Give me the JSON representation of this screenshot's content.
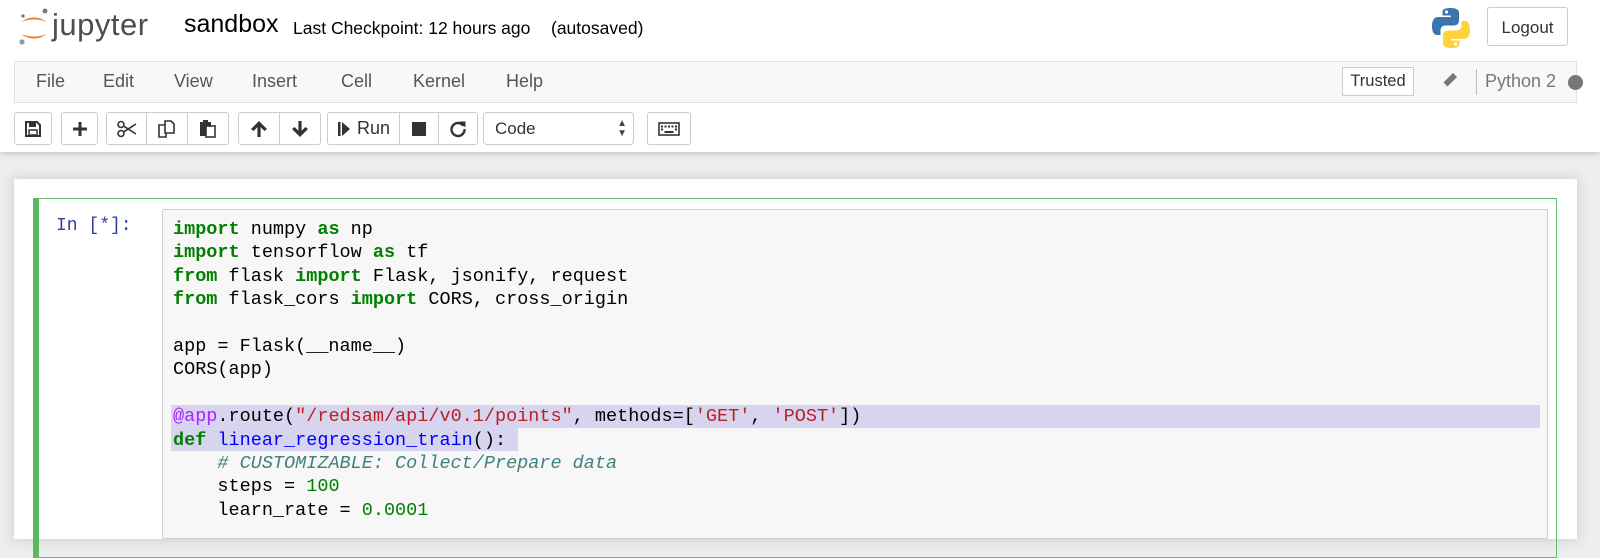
{
  "header": {
    "logo_text": "jupyter",
    "notebook_name": "sandbox",
    "checkpoint": "Last Checkpoint: 12 hours ago",
    "autosave": "(autosaved)",
    "logout_label": "Logout"
  },
  "menubar": {
    "items": [
      "File",
      "Edit",
      "View",
      "Insert",
      "Cell",
      "Kernel",
      "Help"
    ],
    "trusted_label": "Trusted",
    "kernel_name": "Python 2"
  },
  "toolbar": {
    "buttons": [
      "save-icon",
      "plus-icon",
      "scissors-icon",
      "copy-icon",
      "paste-icon",
      "arrow-up-icon",
      "arrow-down-icon",
      "run-icon",
      "stop-icon",
      "restart-icon",
      "keyboard-icon"
    ],
    "run_label": "Run",
    "cell_type": "Code"
  },
  "cell": {
    "prompt": "In [*]:",
    "lines": [
      [
        {
          "t": "import",
          "c": "kw"
        },
        {
          "t": " numpy ",
          "c": "plain"
        },
        {
          "t": "as",
          "c": "kw"
        },
        {
          "t": " np",
          "c": "plain"
        }
      ],
      [
        {
          "t": "import",
          "c": "kw"
        },
        {
          "t": " tensorflow ",
          "c": "plain"
        },
        {
          "t": "as",
          "c": "kw"
        },
        {
          "t": " tf",
          "c": "plain"
        }
      ],
      [
        {
          "t": "from",
          "c": "kw"
        },
        {
          "t": " flask ",
          "c": "plain"
        },
        {
          "t": "import",
          "c": "kw"
        },
        {
          "t": " Flask, jsonify, request",
          "c": "plain"
        }
      ],
      [
        {
          "t": "from",
          "c": "kw"
        },
        {
          "t": " flask_cors ",
          "c": "plain"
        },
        {
          "t": "import",
          "c": "kw"
        },
        {
          "t": " CORS, cross_origin",
          "c": "plain"
        }
      ],
      [],
      [
        {
          "t": "app = Flask(__name__)",
          "c": "plain"
        }
      ],
      [
        {
          "t": "CORS(app)",
          "c": "plain"
        }
      ],
      [],
      [
        {
          "t": "@app",
          "c": "dec"
        },
        {
          "t": ".route(",
          "c": "plain"
        },
        {
          "t": "\"/redsam/api/v0.1/points\"",
          "c": "str"
        },
        {
          "t": ", methods=[",
          "c": "plain"
        },
        {
          "t": "'GET'",
          "c": "str"
        },
        {
          "t": ", ",
          "c": "plain"
        },
        {
          "t": "'POST'",
          "c": "str"
        },
        {
          "t": "])",
          "c": "plain"
        }
      ],
      [
        {
          "t": "def",
          "c": "kw"
        },
        {
          "t": " ",
          "c": "plain"
        },
        {
          "t": "linear_regression_train",
          "c": "fn"
        },
        {
          "t": "():",
          "c": "plain"
        }
      ],
      [
        {
          "t": "    ",
          "c": "plain"
        },
        {
          "t": "# CUSTOMIZABLE: Collect/Prepare data",
          "c": "cmt"
        }
      ],
      [
        {
          "t": "    steps = ",
          "c": "plain"
        },
        {
          "t": "100",
          "c": "num"
        }
      ],
      [
        {
          "t": "    learn_rate = ",
          "c": "plain"
        },
        {
          "t": "0.0001",
          "c": "num"
        }
      ]
    ]
  },
  "colors": {
    "code_keyword": "#008000",
    "code_string": "#ba2121",
    "code_comment": "#408080",
    "code_function": "#0000ff",
    "code_decorator": "#aa22ff",
    "cell_border_active": "#5cb85c",
    "prompt": "#303f9f",
    "selection": "#d7d4f0"
  }
}
